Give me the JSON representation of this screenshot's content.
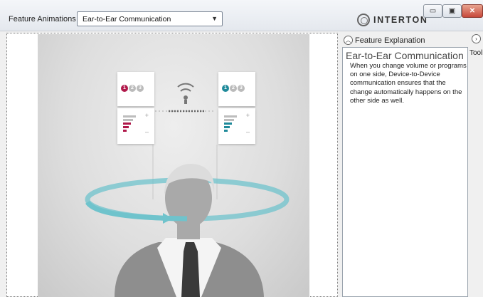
{
  "toolbar": {
    "feature_label": "Feature Animations",
    "dropdown_value": "Ear-to-Ear Communication",
    "brand": "INTERTON"
  },
  "window_controls": {
    "minimize": "▭",
    "maximize": "▣",
    "close": "✕"
  },
  "animation": {
    "left_card": {
      "program_numbers": [
        "1",
        "2",
        "3"
      ],
      "active_program": "1",
      "accent_color": "#b0184a"
    },
    "right_card": {
      "program_numbers": [
        "1",
        "2",
        "3"
      ],
      "active_program": "1",
      "accent_color": "#1f8a9a"
    },
    "ring_color": "#6fc3cc"
  },
  "side_panel": {
    "header_label": "Feature Explanation",
    "title": "Ear-to-Ear Communication",
    "body": "When you change volume or programs on one side, Device-to-Device communication ensures that the change automatically happens on the other side as well.",
    "tools_label": "Tool"
  }
}
